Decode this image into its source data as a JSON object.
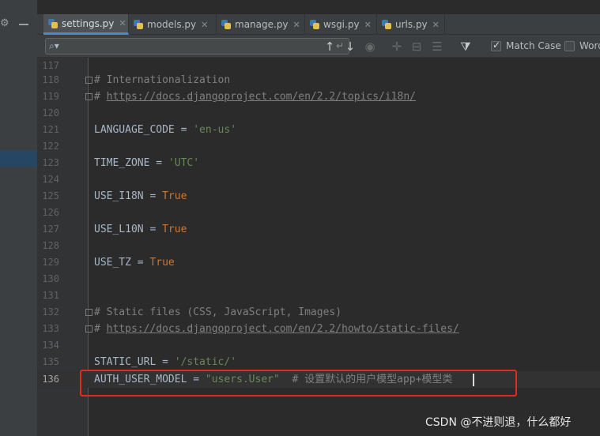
{
  "tabs": [
    {
      "label": "settings.py",
      "active": true
    },
    {
      "label": "models.py",
      "active": false
    },
    {
      "label": "manage.py",
      "active": false
    },
    {
      "label": "wsgi.py",
      "active": false
    },
    {
      "label": "urls.py",
      "active": false
    }
  ],
  "search": {
    "value": "",
    "match_case_label": "Match Case",
    "words_label": "Words"
  },
  "lines": [
    {
      "num": "117",
      "code": ""
    },
    {
      "num": "118",
      "code": "# Internationalization"
    },
    {
      "num": "119",
      "code": "# https://docs.djangoproject.com/en/2.2/topics/i18n/"
    },
    {
      "num": "120",
      "code": ""
    },
    {
      "num": "121",
      "code_a": "LANGUAGE_CODE = ",
      "code_b": "'en-us'"
    },
    {
      "num": "122",
      "code": ""
    },
    {
      "num": "123",
      "code_a": "TIME_ZONE = ",
      "code_b": "'UTC'"
    },
    {
      "num": "124",
      "code": ""
    },
    {
      "num": "125",
      "code_a": "USE_I18N = ",
      "code_b": "True"
    },
    {
      "num": "126",
      "code": ""
    },
    {
      "num": "127",
      "code_a": "USE_L10N = ",
      "code_b": "True"
    },
    {
      "num": "128",
      "code": ""
    },
    {
      "num": "129",
      "code_a": "USE_TZ = ",
      "code_b": "True"
    },
    {
      "num": "130",
      "code": ""
    },
    {
      "num": "131",
      "code": ""
    },
    {
      "num": "132",
      "code": "# Static files (CSS, JavaScript, Images)"
    },
    {
      "num": "133",
      "code": "# https://docs.djangoproject.com/en/2.2/howto/static-files/"
    },
    {
      "num": "134",
      "code": ""
    },
    {
      "num": "135",
      "code_a": "STATIC_URL = ",
      "code_b": "'/static/'"
    },
    {
      "num": "136",
      "code_a": "AUTH_USER_MODEL = ",
      "code_b": "\"users.User\"",
      "code_c": "  # 设置默认的用户模型app+模型类"
    }
  ],
  "comments": {
    "l118_hash": "#",
    "l118_text": " Internationalization",
    "l119_hash": "# ",
    "l119_link": "https://docs.djangoproject.com/en/2.2/topics/i18n/",
    "l132_hash": "#",
    "l132_text": " Static files (CSS, JavaScript, Images)",
    "l133_hash": "# ",
    "l133_link": "https://docs.djangoproject.com/en/2.2/howto/static-files/"
  },
  "watermark": "CSDN @不进则退，什么都好",
  "colors": {
    "keyword": "#cc7832",
    "string": "#6a8759",
    "comment": "#808080",
    "highlight_box": "#e8281f"
  }
}
